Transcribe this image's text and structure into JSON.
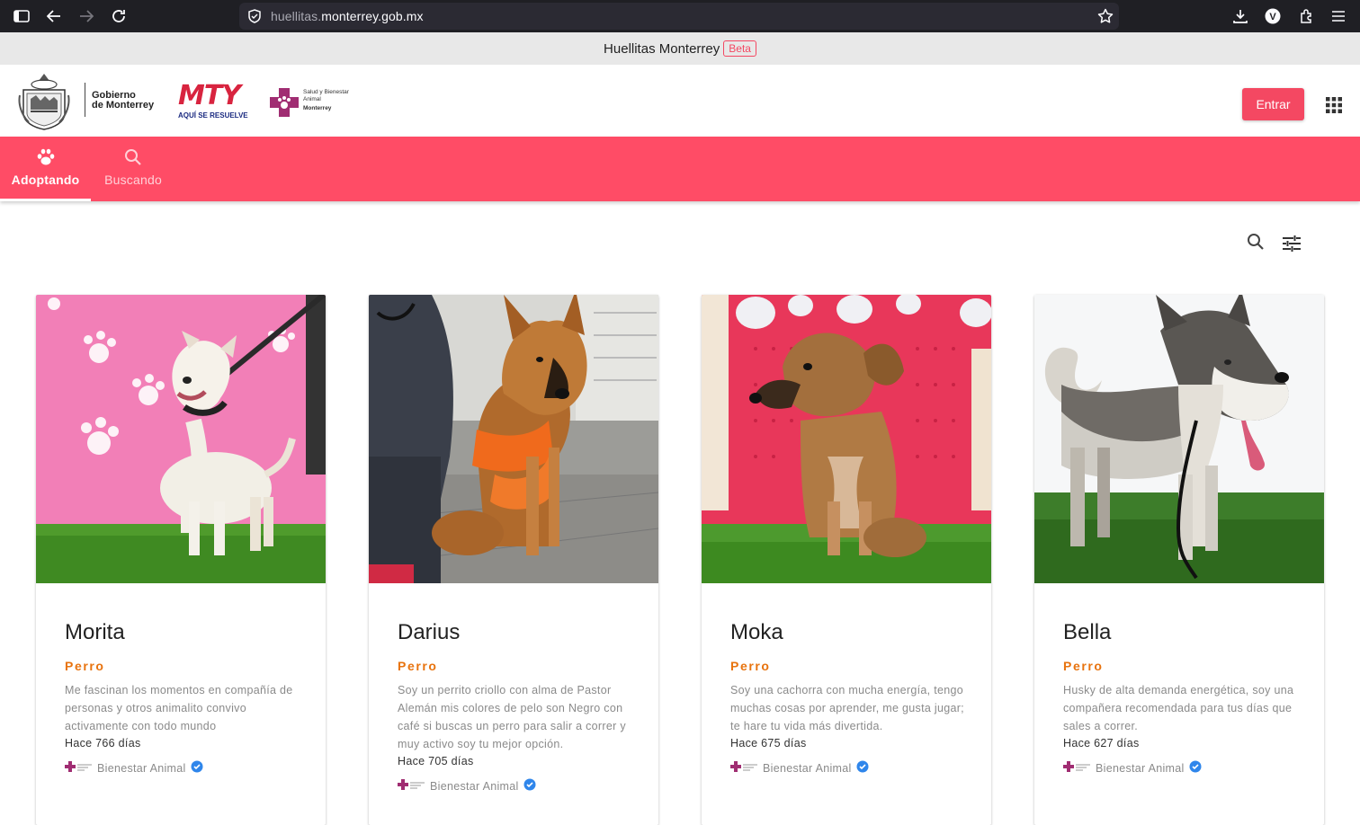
{
  "browser": {
    "url_dim": "huellitas.",
    "url_main": "monterrey.gob.mx",
    "profile_initial": "V"
  },
  "banner": {
    "title": "Huellitas Monterrey",
    "badge": "Beta"
  },
  "header": {
    "gov_logo_line1": "Gobierno",
    "gov_logo_line2": "de Monterrey",
    "mty_logo": "MTY",
    "mty_tagline": "AQUÍ SE RESUELVE",
    "salud_line1": "Salud y Bienestar",
    "salud_line2": "Animal",
    "salud_line3": "Monterrey",
    "login_label": "Entrar"
  },
  "tabs": [
    {
      "label": "Adoptando",
      "icon": "paw-icon",
      "active": true
    },
    {
      "label": "Buscando",
      "icon": "search-icon",
      "active": false
    }
  ],
  "toolbar": {
    "search_icon": "search-icon",
    "filter_icon": "tune-icon"
  },
  "pets": [
    {
      "name": "Morita",
      "species": "Perro",
      "description": "Me fascinan los momentos en compañía de personas y otros animalito convivo activamente con todo mundo",
      "posted": "Hace 766 días",
      "org": "Bienestar Animal"
    },
    {
      "name": "Darius",
      "species": "Perro",
      "description": "Soy un perrito criollo con alma de Pastor Alemán mis colores de pelo  son Negro con café si buscas un perro para salir a correr y muy activo soy tu mejor opción.",
      "posted": "Hace 705 días",
      "org": "Bienestar Animal"
    },
    {
      "name": "Moka",
      "species": "Perro",
      "description": "Soy una cachorra con mucha energía, tengo muchas cosas  por aprender, me gusta jugar; te hare tu vida más divertida.",
      "posted": "Hace 675 días",
      "org": "Bienestar Animal"
    },
    {
      "name": "Bella",
      "species": "Perro",
      "description": "Husky de alta demanda energética, soy una compañera recomendada para tus días que sales a correr.",
      "posted": "Hace 627 días",
      "org": "Bienestar Animal"
    }
  ],
  "colors": {
    "accent": "#ff4c66",
    "button": "#f44862",
    "species": "#e8730e",
    "verified": "#2f86eb"
  }
}
